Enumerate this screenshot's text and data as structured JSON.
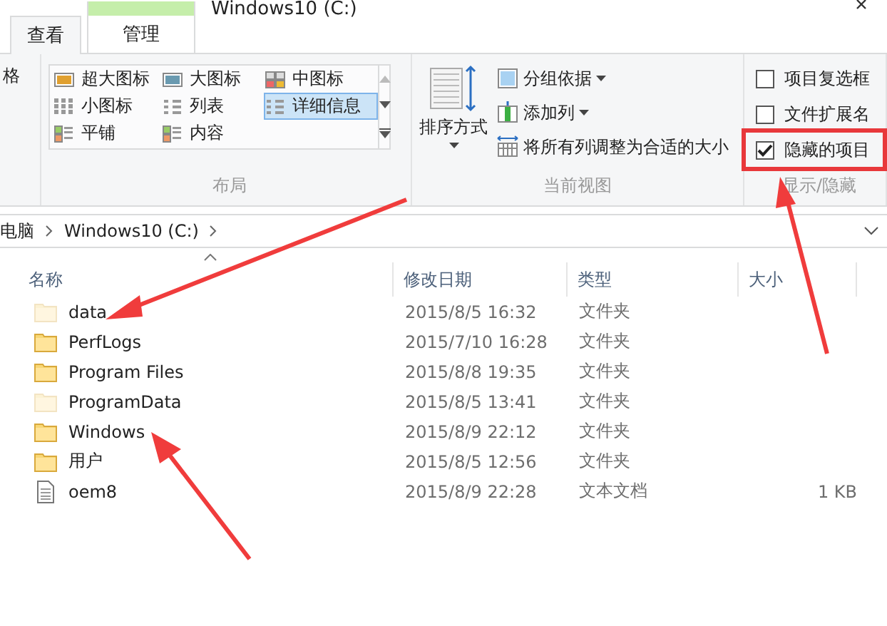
{
  "window": {
    "title": "Windows10 (C:)"
  },
  "ribbon_tabs": [
    {
      "label": "查看",
      "selected": true,
      "kind": "plain"
    },
    {
      "label": "管理",
      "selected": false,
      "kind": "contextual"
    }
  ],
  "ribbon": {
    "pane_label": "格",
    "layout": {
      "label": "布局",
      "options": [
        {
          "label": "超大图标",
          "selected": false,
          "kind": "xl"
        },
        {
          "label": "大图标",
          "selected": false,
          "kind": "l"
        },
        {
          "label": "中图标",
          "selected": false,
          "kind": "m"
        },
        {
          "label": "小图标",
          "selected": false,
          "kind": "s"
        },
        {
          "label": "列表",
          "selected": false,
          "kind": "list"
        },
        {
          "label": "详细信息",
          "selected": true,
          "kind": "details"
        },
        {
          "label": "平铺",
          "selected": false,
          "kind": "tiles"
        },
        {
          "label": "内容",
          "selected": false,
          "kind": "content"
        }
      ]
    },
    "current_view": {
      "label": "当前视图",
      "sort_label": "排序方式",
      "items": [
        {
          "label": "分组依据",
          "kind": "group",
          "dropdown": true
        },
        {
          "label": "添加列",
          "kind": "addcol",
          "dropdown": true
        },
        {
          "label": "将所有列调整为合适的大小",
          "kind": "fit",
          "dropdown": false
        }
      ]
    },
    "show_hide": {
      "label": "显示/隐藏",
      "checkboxes": [
        {
          "label": "项目复选框",
          "checked": false,
          "highlighted": false
        },
        {
          "label": "文件扩展名",
          "checked": false,
          "highlighted": false
        },
        {
          "label": "隐藏的项目",
          "checked": true,
          "highlighted": true
        }
      ]
    }
  },
  "address": {
    "path": [
      "电脑",
      "Windows10 (C:)"
    ]
  },
  "table": {
    "columns": [
      "名称",
      "修改日期",
      "类型",
      "大小"
    ],
    "rows": [
      {
        "name": "data",
        "date": "2015/8/5 16:32",
        "type": "文件夹",
        "kind": "folder",
        "hidden": true
      },
      {
        "name": "PerfLogs",
        "date": "2015/7/10 16:28",
        "type": "文件夹",
        "kind": "folder",
        "hidden": false
      },
      {
        "name": "Program Files",
        "date": "2015/8/8 19:35",
        "type": "文件夹",
        "kind": "folder",
        "hidden": false
      },
      {
        "name": "ProgramData",
        "date": "2015/8/5 13:41",
        "type": "文件夹",
        "kind": "folder",
        "hidden": true
      },
      {
        "name": "Windows",
        "date": "2015/8/9 22:12",
        "type": "文件夹",
        "kind": "folder",
        "hidden": false
      },
      {
        "name": "用户",
        "date": "2015/8/5 12:56",
        "type": "文件夹",
        "kind": "folder",
        "hidden": false
      },
      {
        "name": "oem8",
        "date": "2015/8/9 22:28",
        "type": "文本文档",
        "size": "1 KB",
        "kind": "file",
        "hidden": false
      }
    ]
  }
}
